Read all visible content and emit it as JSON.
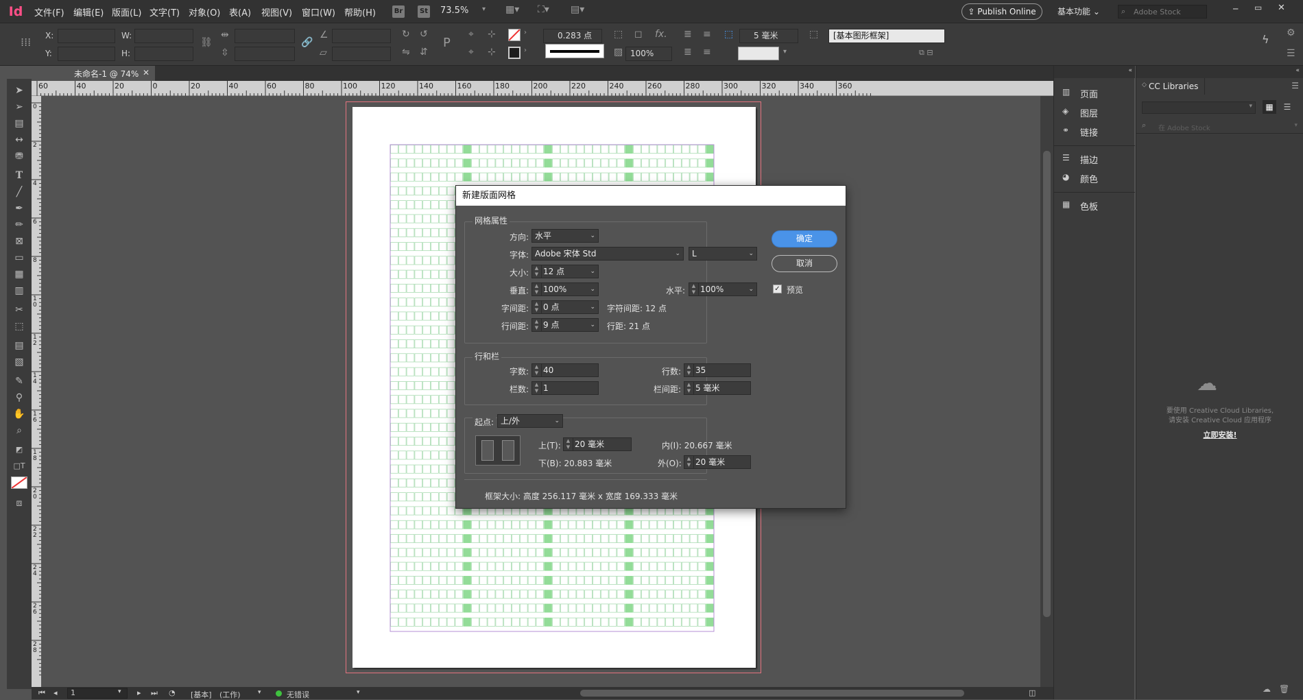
{
  "app": {
    "logo": "Id"
  },
  "menu": [
    "文件(F)",
    "编辑(E)",
    "版面(L)",
    "文字(T)",
    "对象(O)",
    "表(A)",
    "视图(V)",
    "窗口(W)",
    "帮助(H)"
  ],
  "topbar": {
    "br_label": "Br",
    "st_label": "St",
    "zoom": "73.5%",
    "publish_label": "Publish Online",
    "workspace": "基本功能",
    "stock_placeholder": "Adobe Stock"
  },
  "control": {
    "x_label": "X:",
    "y_label": "Y:",
    "w_label": "W:",
    "h_label": "H:",
    "stroke_weight": "0.283 点",
    "opacity": "100%",
    "grid_gap": "5 毫米",
    "frame_style": "[基本图形框架]"
  },
  "document": {
    "tab_name": "未命名-1 @ 74%",
    "ruler_labels": [
      "60",
      "40",
      "20",
      "0",
      "20",
      "40",
      "60",
      "80",
      "100",
      "120",
      "140",
      "160",
      "180",
      "200",
      "220",
      "240",
      "260",
      "280",
      "300",
      "320",
      "340",
      "360"
    ],
    "vruler_labels": [
      "0",
      "2",
      "4",
      "6",
      "8",
      "1\n0",
      "1\n2",
      "1\n4",
      "1\n6",
      "1\n8",
      "2\n0",
      "2\n2",
      "2\n4",
      "2\n6",
      "2\n8"
    ]
  },
  "status": {
    "page": "1",
    "mode": "[基本]",
    "mode_sub": "(工作)",
    "preflight": "无错误"
  },
  "panels": {
    "items": [
      "页面",
      "图层",
      "链接",
      "描边",
      "颜色",
      "色板"
    ],
    "cc": {
      "title": "CC Libraries",
      "search_placeholder": "在 Adobe Stock",
      "message1": "要使用 Creative Cloud Libraries,",
      "message2": "请安装 Creative Cloud 应用程序",
      "install_link": "立即安装!"
    }
  },
  "dialog": {
    "title": "新建版面网格",
    "grid_props_label": "网格属性",
    "direction_label": "方向:",
    "direction": "水平",
    "font_label": "字体:",
    "font": "Adobe 宋体 Std",
    "font_style": "L",
    "size_label": "大小:",
    "size": "12 点",
    "vertical_label": "垂直:",
    "vertical": "100%",
    "horizontal_label": "水平:",
    "horizontal": "100%",
    "char_spacing_label": "字间距:",
    "char_spacing": "0 点",
    "char_pitch": "字符间距: 12 点",
    "line_spacing_label": "行间距:",
    "line_spacing": "9 点",
    "line_pitch": "行距: 21 点",
    "rows_cols_label": "行和栏",
    "chars_label": "字数:",
    "chars": "40",
    "lines_label": "行数:",
    "lines": "35",
    "columns_label": "栏数:",
    "columns": "1",
    "gutter_label": "栏间距:",
    "gutter": "5 毫米",
    "start_label": "起点:",
    "start": "上/外",
    "top_label": "上(T):",
    "top": "20 毫米",
    "inside": "内(I): 20.667 毫米",
    "bottom": "下(B): 20.883 毫米",
    "outside_label": "外(O):",
    "outside": "20 毫米",
    "frame_size": "框架大小: 高度 256.117 毫米 x 宽度 169.333 毫米",
    "ok": "确定",
    "cancel": "取消",
    "preview": "预览"
  }
}
